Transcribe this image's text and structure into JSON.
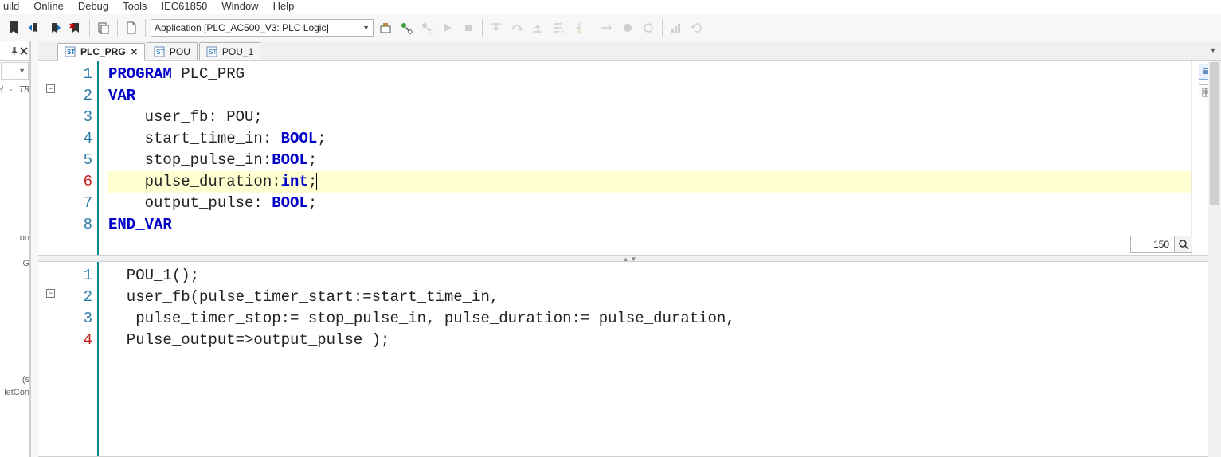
{
  "menu": {
    "items": [
      "uild",
      "Online",
      "Debug",
      "Tools",
      "IEC61850",
      "Window",
      "Help"
    ]
  },
  "toolbar": {
    "app_selector": "Application [PLC_AC500_V3: PLC Logic]"
  },
  "left_panel": {
    "fragments": [
      "TH - TB",
      "on",
      "G",
      "s)",
      "letCon"
    ]
  },
  "tabs": [
    {
      "label": "PLC_PRG",
      "active": true,
      "closable": true
    },
    {
      "label": "POU",
      "active": false,
      "closable": false
    },
    {
      "label": "POU_1",
      "active": false,
      "closable": false
    }
  ],
  "declaration": {
    "zoom": "150",
    "lines": [
      {
        "n": 1,
        "tokens": [
          [
            "kw",
            "PROGRAM"
          ],
          [
            "",
            " PLC_PRG"
          ]
        ]
      },
      {
        "n": 2,
        "tokens": [
          [
            "kw",
            "VAR"
          ]
        ]
      },
      {
        "n": 3,
        "tokens": [
          [
            "",
            "    user_fb: POU;"
          ]
        ]
      },
      {
        "n": 4,
        "tokens": [
          [
            "",
            "    start_time_in: "
          ],
          [
            "typ",
            "BOOL"
          ],
          [
            "",
            ";"
          ]
        ]
      },
      {
        "n": 5,
        "tokens": [
          [
            "",
            "    stop_pulse_in:"
          ],
          [
            "typ",
            "BOOL"
          ],
          [
            "",
            ";"
          ]
        ]
      },
      {
        "n": 6,
        "hl": true,
        "mod": true,
        "tokens": [
          [
            "",
            "    pulse_duration:"
          ],
          [
            "typ",
            "int"
          ],
          [
            "",
            ";"
          ],
          [
            "caret",
            ""
          ]
        ]
      },
      {
        "n": 7,
        "tokens": [
          [
            "",
            "    output_pulse: "
          ],
          [
            "typ",
            "BOOL"
          ],
          [
            "",
            ";"
          ]
        ]
      },
      {
        "n": 8,
        "tokens": [
          [
            "kw",
            "END_VAR"
          ]
        ]
      }
    ]
  },
  "body": {
    "lines": [
      {
        "n": 1,
        "tokens": [
          [
            "",
            "  POU_1();"
          ]
        ]
      },
      {
        "n": 2,
        "tokens": [
          [
            "",
            "  user_fb(pulse_timer_start:=start_time_in,"
          ]
        ]
      },
      {
        "n": 3,
        "tokens": [
          [
            "",
            "   pulse_timer_stop:= stop_pulse_in, pulse_duration:= pulse_duration,"
          ]
        ]
      },
      {
        "n": 4,
        "mod": true,
        "tokens": [
          [
            "",
            "  Pulse_output=>output_pulse );"
          ]
        ]
      }
    ]
  }
}
